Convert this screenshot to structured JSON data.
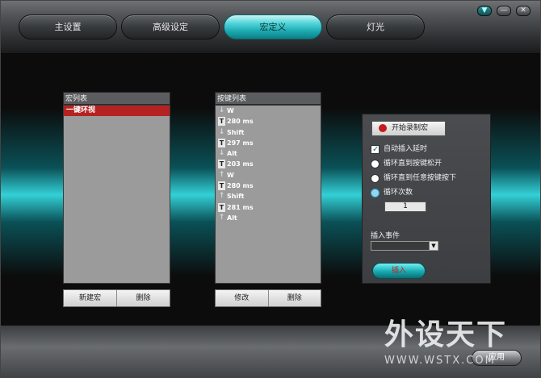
{
  "tabs": [
    {
      "label": "主设置"
    },
    {
      "label": "高级设定"
    },
    {
      "label": "宏定义"
    },
    {
      "label": "灯光"
    }
  ],
  "active_tab": "宏定义",
  "window_controls": {
    "dropdown": "▼",
    "minimize": "—",
    "close": "✕"
  },
  "macro_list": {
    "title": "宏列表",
    "items": [
      {
        "label": "一键环视"
      }
    ],
    "buttons": {
      "new": "新建宏",
      "delete": "删除"
    }
  },
  "key_list": {
    "title": "按键列表",
    "items": [
      {
        "type": "down",
        "icon": "↓",
        "label": "W"
      },
      {
        "type": "time",
        "icon": "T",
        "label": "280 ms"
      },
      {
        "type": "down",
        "icon": "↓",
        "label": "Shift"
      },
      {
        "type": "time",
        "icon": "T",
        "label": "297 ms"
      },
      {
        "type": "down",
        "icon": "↓",
        "label": "Alt"
      },
      {
        "type": "time",
        "icon": "T",
        "label": "203 ms"
      },
      {
        "type": "up",
        "icon": "↑",
        "label": "W"
      },
      {
        "type": "time",
        "icon": "T",
        "label": "280 ms"
      },
      {
        "type": "up",
        "icon": "↑",
        "label": "Shift"
      },
      {
        "type": "time",
        "icon": "T",
        "label": "281 ms"
      },
      {
        "type": "up",
        "icon": "↑",
        "label": "Alt"
      }
    ],
    "buttons": {
      "modify": "修改",
      "delete": "删除"
    }
  },
  "settings": {
    "record_button": "开始录制宏",
    "auto_delay": "自动插入延时",
    "loop_until_release": "循环直到按键松开",
    "loop_until_any": "循环直到任意按键按下",
    "loop_count": "循环次数",
    "loop_count_value": "1",
    "insert_event_label": "插入事件",
    "insert_button": "插入"
  },
  "colors": {
    "accent": "#33d0d6",
    "record": "#c81a1a",
    "selected_row": "#b42222"
  },
  "footer": {
    "button_label": "应用"
  },
  "watermark": {
    "big": "外设天下",
    "small": "WWW.WSTX.COM"
  }
}
